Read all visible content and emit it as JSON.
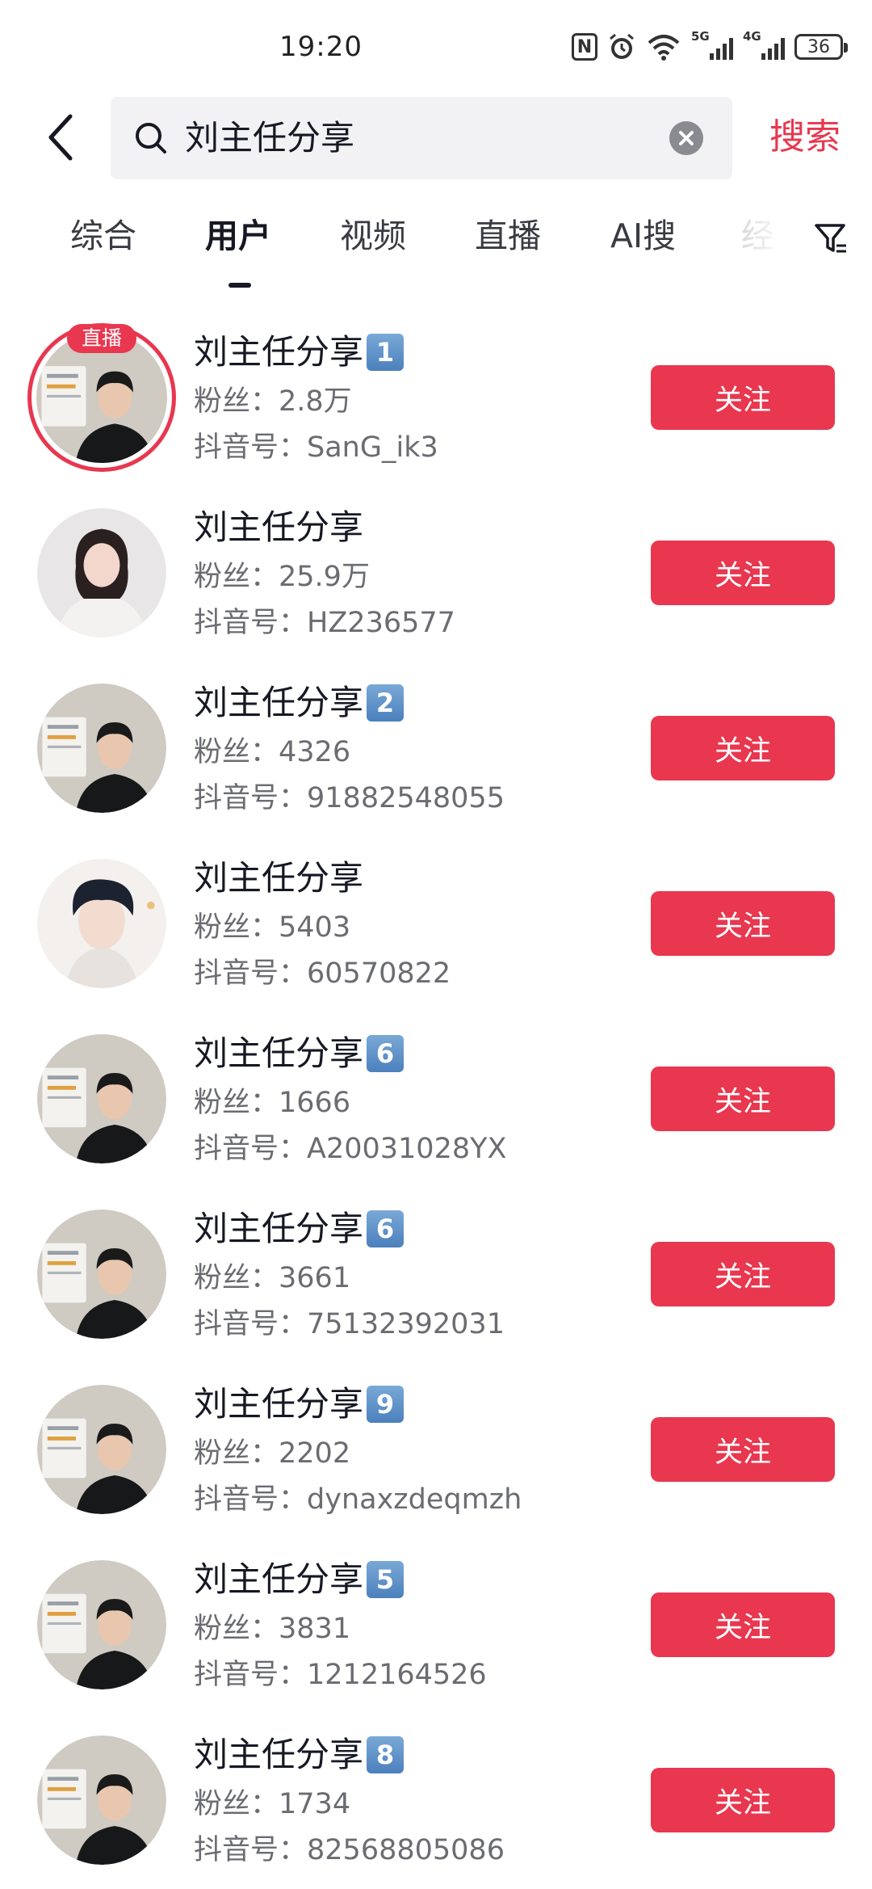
{
  "status_bar": {
    "time": "19:20",
    "net1_label": "5G",
    "net2_label": "4G",
    "battery": "36",
    "nfc": "N"
  },
  "search": {
    "query": "刘主任分享",
    "submit_label": "搜索"
  },
  "tabs": [
    {
      "label": "综合"
    },
    {
      "label": "用户"
    },
    {
      "label": "视频"
    },
    {
      "label": "直播"
    },
    {
      "label": "AI搜"
    },
    {
      "label": "经"
    }
  ],
  "live_badge": "直播",
  "fans_prefix": "粉丝：",
  "id_prefix": "抖音号：",
  "follow_label": "关注",
  "users": [
    {
      "name": "刘主任分享",
      "badge": "1",
      "fans": "2.8万",
      "id": "SanG_ik3",
      "avatar": "man-whiteboard"
    },
    {
      "name": "刘主任分享",
      "badge": "",
      "fans": "25.9万",
      "id": "HZ236577",
      "avatar": "woman"
    },
    {
      "name": "刘主任分享",
      "badge": "2",
      "fans": "4326",
      "id": "91882548055",
      "avatar": "man-whiteboard"
    },
    {
      "name": "刘主任分享",
      "badge": "",
      "fans": "5403",
      "id": "60570822",
      "avatar": "illustrated-man"
    },
    {
      "name": "刘主任分享",
      "badge": "6",
      "fans": "1666",
      "id": "A20031028YX",
      "avatar": "man-whiteboard"
    },
    {
      "name": "刘主任分享",
      "badge": "6",
      "fans": "3661",
      "id": "75132392031",
      "avatar": "man-whiteboard"
    },
    {
      "name": "刘主任分享",
      "badge": "9",
      "fans": "2202",
      "id": "dynaxzdeqmzh",
      "avatar": "man-whiteboard"
    },
    {
      "name": "刘主任分享",
      "badge": "5",
      "fans": "3831",
      "id": "1212164526",
      "avatar": "man-whiteboard"
    },
    {
      "name": "刘主任分享",
      "badge": "8",
      "fans": "1734",
      "id": "82568805086",
      "avatar": "man-whiteboard"
    }
  ],
  "colors": {
    "accent": "#e8374f",
    "text_primary": "#161823",
    "text_secondary": "#6b6c72",
    "search_bg": "#f2f2f4"
  }
}
